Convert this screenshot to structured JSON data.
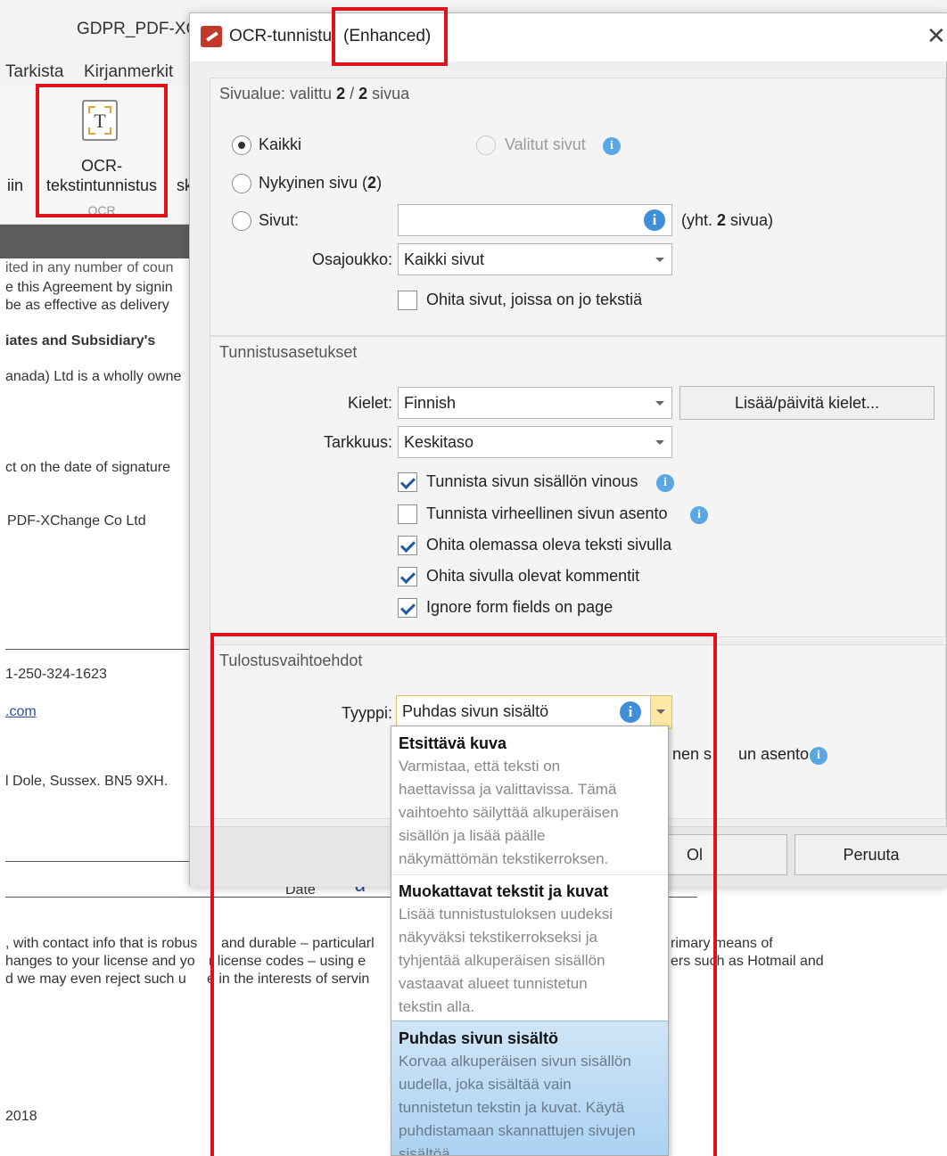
{
  "app": {
    "title": "GDPR_PDF-XCl",
    "tabs": [
      "Tarkista",
      "Kirjanmerkit"
    ],
    "ocr_button": {
      "line1": "OCR-",
      "line2": "tekstintunnistus",
      "group": "OCR"
    },
    "side_left": "iin",
    "side_right": "sk",
    "document_lines": [
      "ited in any number of coun",
      "e this Agreement by signin",
      " be as effective as delivery",
      "iates and Subsidiary's",
      "anada) Ltd is a wholly owne",
      "ct on the date of signature",
      "PDF-XChange Co Ltd",
      "1-250-324-1623",
      ".com",
      "l Dole, Sussex. BN5 9XH.",
      "Date",
      "α",
      ", with contact info that is robus",
      "and durable – particularl",
      "hanges to your license and yo",
      "r license codes – using e",
      "d we may even reject such u",
      "e in the interests of servin",
      "rimary means of",
      "ers such as Hotmail and",
      "2018"
    ]
  },
  "dialog": {
    "title": "OCR-tunnistu",
    "title_suffix": "(Enhanced)",
    "close_glyph": "✕",
    "page_range": {
      "title_prefix": "Sivualue: valittu ",
      "title_selected": "2",
      "title_mid": " / ",
      "title_total": "2",
      "title_suffix": " sivua",
      "all_label": "Kaikki",
      "selected_pages_label": "Valitut sivut",
      "current_page_label": "Nykyinen sivu (",
      "current_page_num": "2",
      "current_page_close": ")",
      "pages_label": "Sivut:",
      "pages_value": "",
      "total_prefix": "(yht. ",
      "total_num": "2",
      "total_suffix": " sivua)",
      "subset_label": "Osajoukko:",
      "subset_value": "Kaikki sivut",
      "skip_text_pages_label": "Ohita sivut, joissa on jo tekstiä"
    },
    "recognition": {
      "title": "Tunnistusasetukset",
      "languages_label": "Kielet:",
      "languages_value": "Finnish",
      "update_languages_button": "Lisää/päivitä kielet...",
      "accuracy_label": "Tarkkuus:",
      "accuracy_value": "Keskitaso",
      "options": [
        {
          "label": "Tunnista sivun sisällön vinous",
          "checked": true,
          "info": true
        },
        {
          "label": "Tunnista virheellinen sivun asento",
          "checked": false,
          "info": true
        },
        {
          "label": "Ohita olemassa oleva teksti sivulla",
          "checked": true,
          "info": false
        },
        {
          "label": "Ohita sivulla olevat kommentit",
          "checked": true,
          "info": false
        },
        {
          "label": "Ignore form fields on page",
          "checked": true,
          "info": false
        }
      ]
    },
    "output": {
      "title": "Tulostusvaihtoehdot",
      "type_label": "Tyyppi:",
      "type_value": "Puhdas sivun sisältö",
      "hidden_option_tail_1": "nen s",
      "hidden_option_tail_2": "un asento"
    },
    "ok_button": "OK",
    "ok_visible": "Ol",
    "cancel_button": "Peruuta"
  },
  "dropdown": {
    "items": [
      {
        "title": "Etsittävä kuva",
        "desc": [
          "Varmistaa, että teksti on",
          "haettavissa ja valittavissa. Tämä",
          "vaihtoehto säilyttää alkuperäisen",
          "sisällön ja lisää päälle",
          "näkymättömän tekstikerroksen."
        ],
        "selected": false
      },
      {
        "title": "Muokattavat tekstit ja kuvat",
        "desc": [
          "Lisää tunnistustuloksen uudeksi",
          "näkyväksi tekstikerrokseksi ja",
          "tyhjentää alkuperäisen sisällön",
          "vastaavat alueet tunnistetun",
          "tekstin alla."
        ],
        "selected": false
      },
      {
        "title": "Puhdas sivun sisältö",
        "desc": [
          "Korvaa alkuperäisen sivun sisällön",
          "uudella, joka sisältää vain",
          "tunnistetun tekstin ja kuvat. Käytä",
          "puhdistamaan skannattujen sivujen",
          "sisältöä."
        ],
        "selected": true
      }
    ]
  },
  "colors": {
    "annotation_red": "#e0121b",
    "selection_blue": "#a9d1f2",
    "info_blue": "#5aa7e6"
  }
}
